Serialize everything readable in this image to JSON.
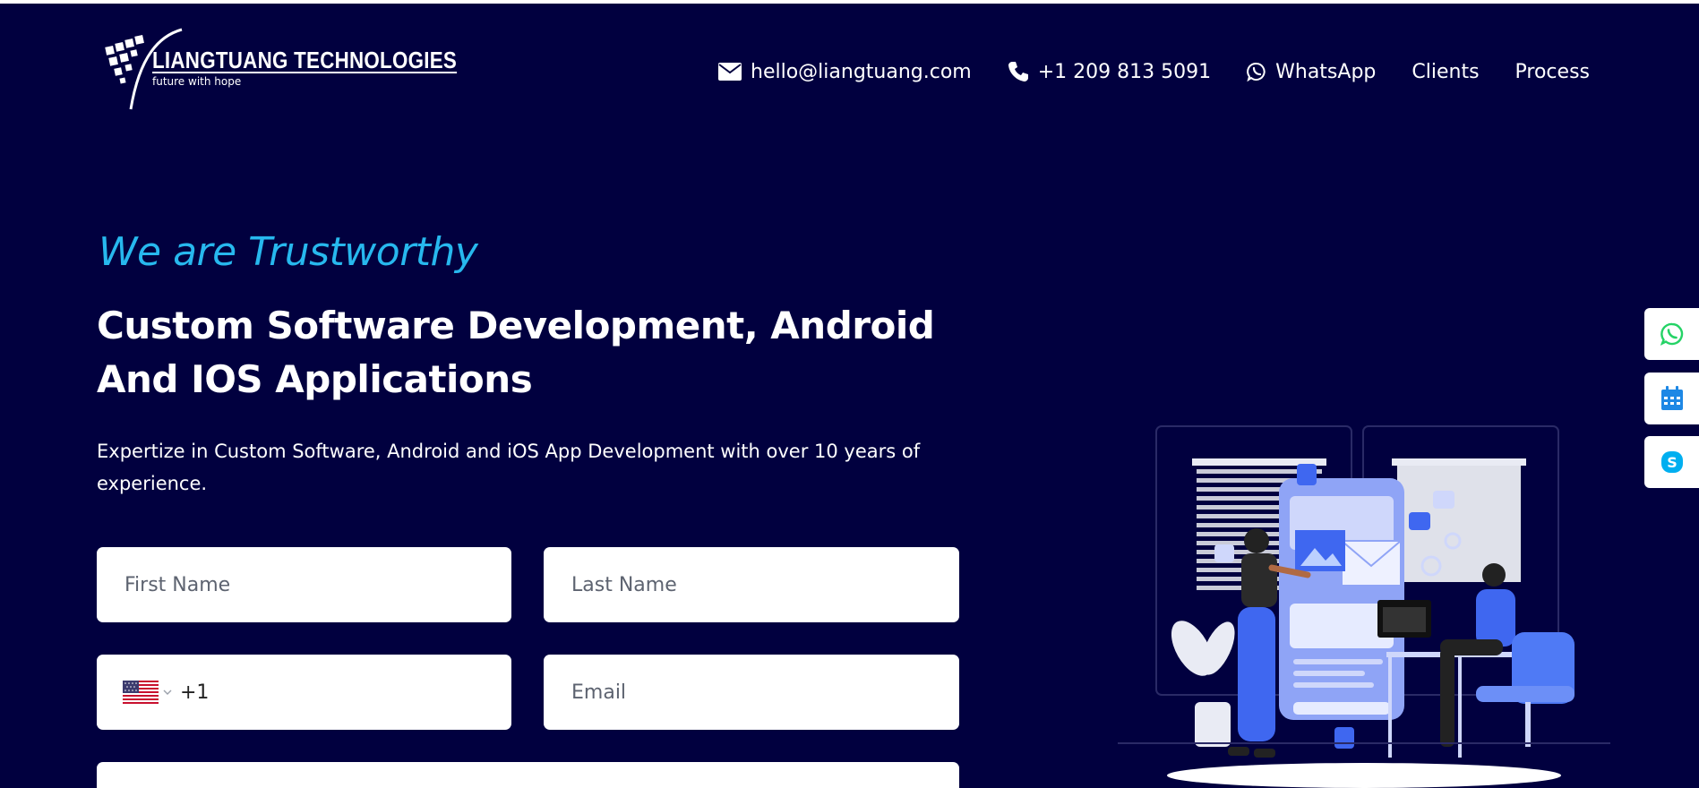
{
  "brand": {
    "name": "LIANGTUANG TECHNOLOGIES",
    "tagline": "future with hope"
  },
  "nav": {
    "email": {
      "label": "hello@liangtuang.com",
      "icon": "envelope-icon"
    },
    "phone": {
      "label": "+1 209 813 5091",
      "icon": "phone-icon"
    },
    "whatsapp": {
      "label": "WhatsApp",
      "icon": "whatsapp-icon"
    },
    "clients": {
      "label": "Clients"
    },
    "process": {
      "label": "Process"
    }
  },
  "hero": {
    "eyebrow": "We are Trustworthy",
    "headline_line1": "Custom Software Development, Android",
    "headline_line2": "And IOS Applications",
    "subtext": "Expertize in Custom Software, Android and iOS App Development with over 10 years of experience."
  },
  "form": {
    "first_name_placeholder": "First Name",
    "last_name_placeholder": "Last Name",
    "phone_country_code": "+1",
    "phone_country_flag": "us-flag-icon",
    "email_placeholder": "Email"
  },
  "sidebar": {
    "items": [
      {
        "icon": "whatsapp-icon",
        "color": "#25d366"
      },
      {
        "icon": "calendar-icon",
        "color": "#1e88e5"
      },
      {
        "icon": "skype-icon",
        "color": "#00aff0"
      }
    ]
  },
  "colors": {
    "background": "#01003f",
    "accent": "#27b8ee",
    "text": "#ffffff"
  }
}
